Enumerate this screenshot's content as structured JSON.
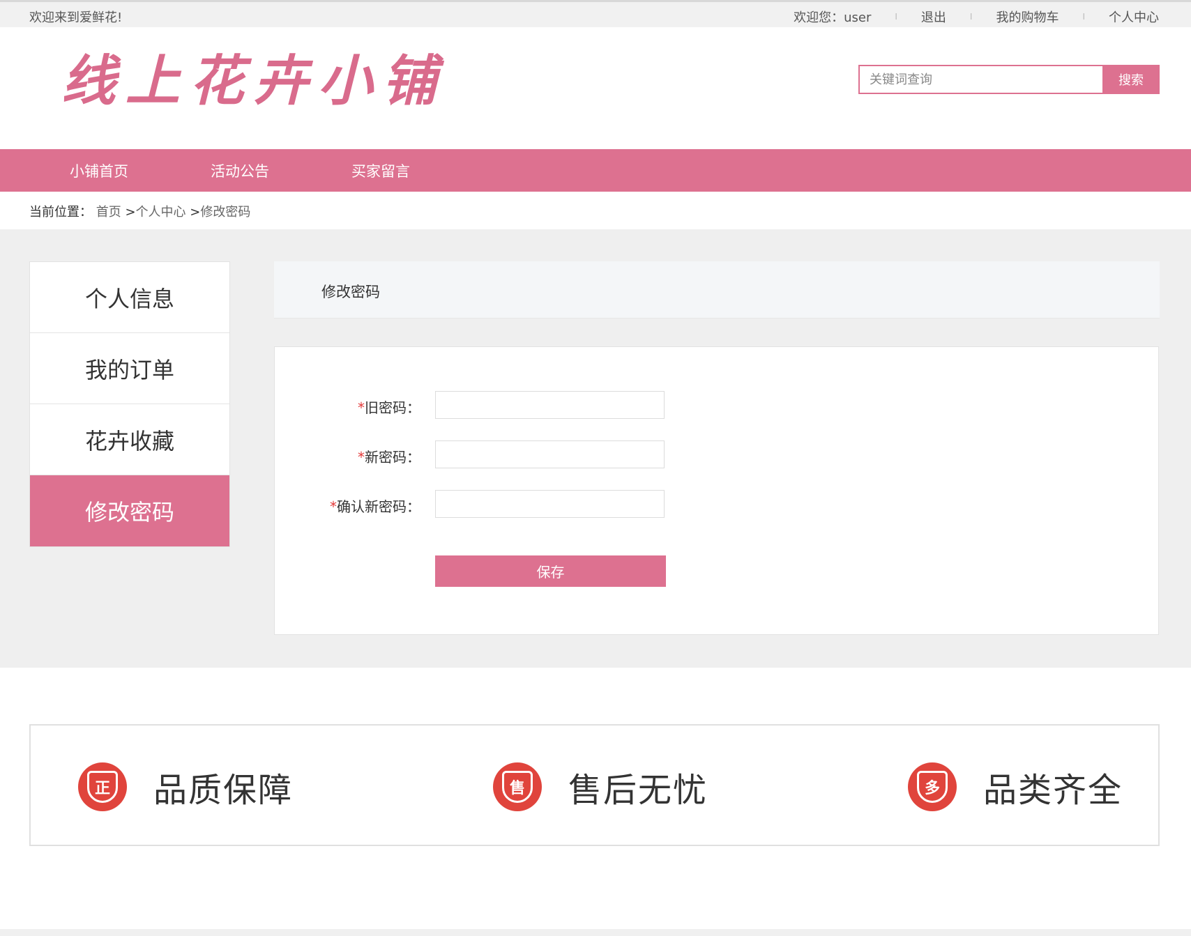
{
  "topbar": {
    "welcome": "欢迎来到爱鲜花!",
    "greeting": "欢迎您：user",
    "logout": "退出",
    "cart": "我的购物车",
    "profile": "个人中心",
    "separator": "I"
  },
  "header": {
    "logo": "线上花卉小铺",
    "search_placeholder": "关键词查询",
    "search_button": "搜索"
  },
  "nav": {
    "items": [
      "小铺首页",
      "活动公告",
      "买家留言"
    ]
  },
  "breadcrumb": {
    "label": "当前位置：",
    "home": "首页",
    "sep": ">",
    "center": "个人中心",
    "current": "修改密码"
  },
  "sidebar": {
    "items": [
      {
        "label": "个人信息",
        "active": false
      },
      {
        "label": "我的订单",
        "active": false
      },
      {
        "label": "花卉收藏",
        "active": false
      },
      {
        "label": "修改密码",
        "active": true
      }
    ]
  },
  "panel": {
    "title": "修改密码"
  },
  "form": {
    "required_mark": "*",
    "old_password_label": "旧密码：",
    "new_password_label": "新密码：",
    "confirm_password_label": "确认新密码：",
    "old_password_value": "",
    "new_password_value": "",
    "confirm_password_value": "",
    "save_button": "保存"
  },
  "guarantees": [
    {
      "icon": "zheng-shield-icon",
      "glyph": "正",
      "label": "品质保障"
    },
    {
      "icon": "shou-shield-icon",
      "glyph": "售",
      "label": "售后无忧"
    },
    {
      "icon": "duo-shield-icon",
      "glyph": "多",
      "label": "品类齐全"
    }
  ],
  "colors": {
    "accent": "#dd7190",
    "guarantee_red": "#e0443c",
    "content_bg": "#efefef"
  }
}
